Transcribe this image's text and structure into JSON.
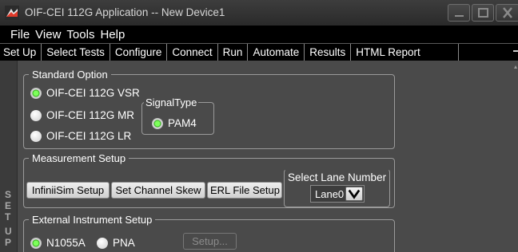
{
  "window": {
    "title": "OIF-CEI 112G Application -- New Device1",
    "minimize_icon": "minimize-icon",
    "maximize_icon": "maximize-icon",
    "close_icon": "close-icon"
  },
  "menu": [
    "File",
    "View",
    "Tools",
    "Help"
  ],
  "tabs": [
    "Set Up",
    "Select Tests",
    "Configure",
    "Connect",
    "Run",
    "Automate",
    "Results",
    "HTML Report"
  ],
  "side_label": [
    "S",
    "E",
    "T",
    "U",
    "P"
  ],
  "standard_option": {
    "legend": "Standard Option",
    "options": [
      "OIF-CEI 112G VSR",
      "OIF-CEI 112G MR",
      "OIF-CEI 112G LR"
    ],
    "selected": "OIF-CEI 112G VSR"
  },
  "signal_type": {
    "legend": "SignalType",
    "options": [
      "PAM4"
    ],
    "selected": "PAM4"
  },
  "measurement_setup": {
    "legend": "Measurement Setup",
    "buttons": [
      "InfiniiSim Setup",
      "Set Channel Skew",
      "ERL File Setup"
    ],
    "lane_label": "Select Lane Number",
    "lane_value": "Lane0"
  },
  "external_instrument": {
    "legend": "External Instrument Setup",
    "options": [
      "N1055A",
      "PNA"
    ],
    "selected": "N1055A",
    "setup_button": "Setup..."
  },
  "colors": {
    "background": "#4a4a4a",
    "menubar": "#000000",
    "radio_selected": "#2fa81a"
  }
}
